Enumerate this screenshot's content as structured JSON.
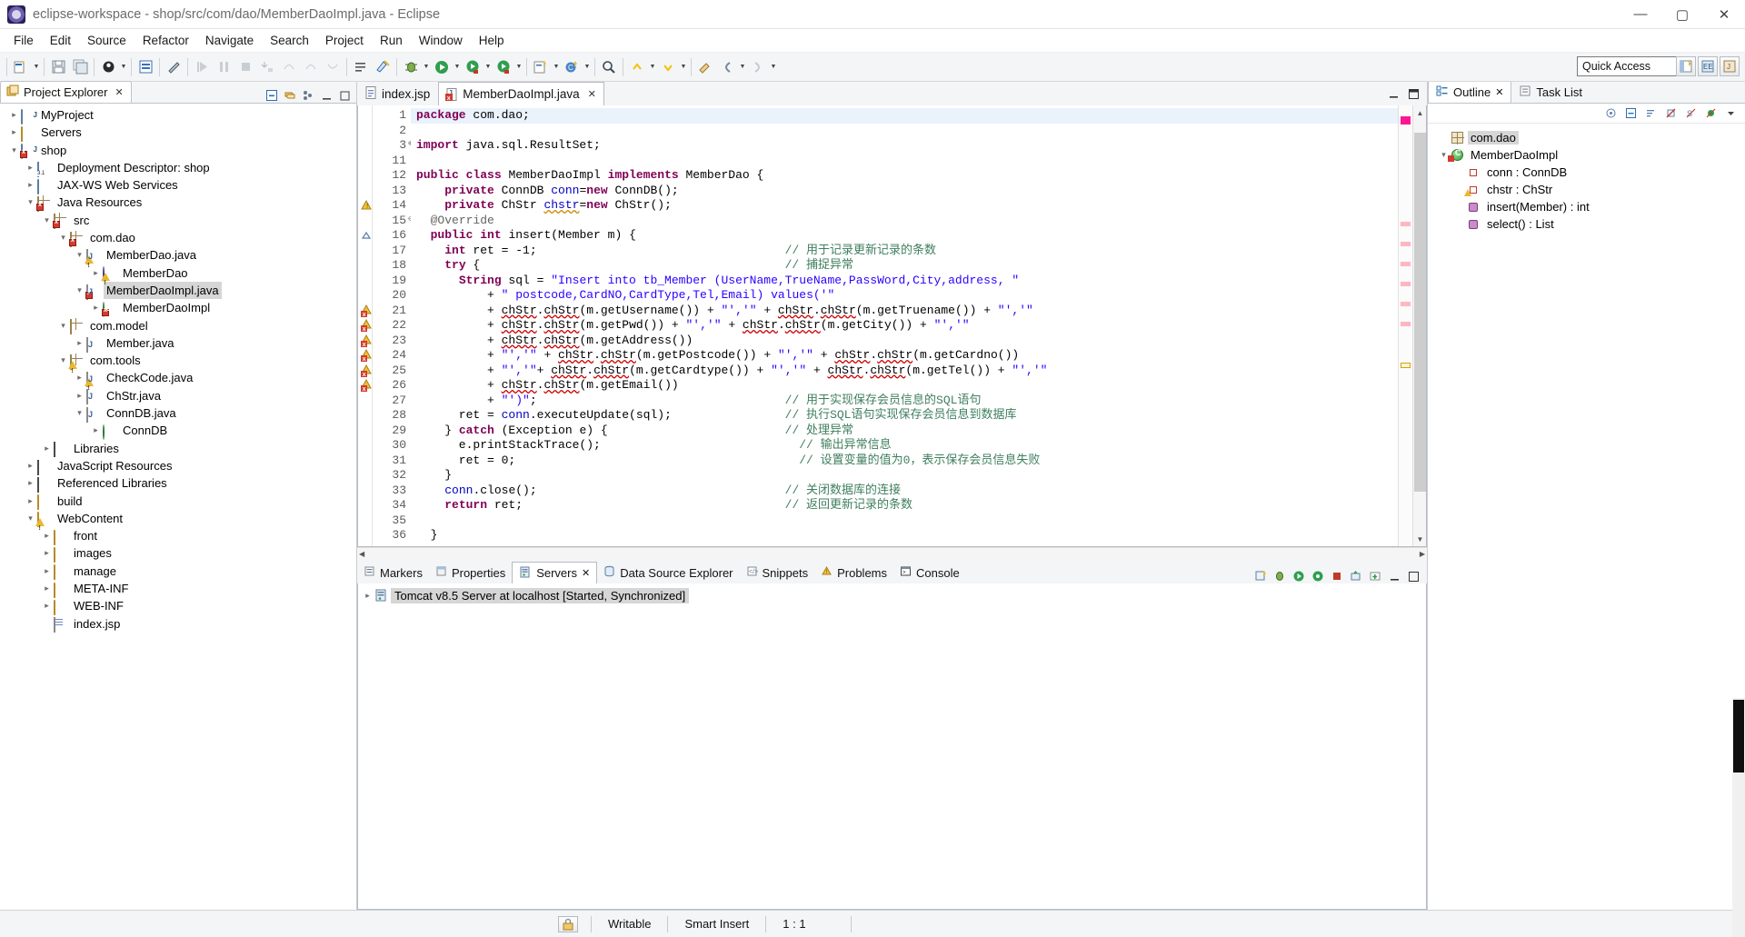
{
  "window": {
    "title": "eclipse-workspace - shop/src/com/dao/MemberDaoImpl.java - Eclipse",
    "minimize": "—",
    "maximize": "▢",
    "close": "✕"
  },
  "menu": {
    "items": [
      "File",
      "Edit",
      "Source",
      "Refactor",
      "Navigate",
      "Search",
      "Project",
      "Run",
      "Window",
      "Help"
    ]
  },
  "toolbar": {
    "quick_access_placeholder": "Quick Access",
    "quick_access_value": "Quick Access"
  },
  "project_explorer": {
    "tab_label": "Project Explorer",
    "close_glyph": "✕",
    "tree": [
      {
        "label": "MyProject",
        "indent": 0,
        "twisty": "▸",
        "icon": "java-project-icon"
      },
      {
        "label": "Servers",
        "indent": 0,
        "twisty": "▸",
        "icon": "folder-icon"
      },
      {
        "label": "shop",
        "indent": 0,
        "twisty": "▾",
        "icon": "java-project-error-icon"
      },
      {
        "label": "Deployment Descriptor: shop",
        "indent": 1,
        "twisty": "▸",
        "icon": "deployment-descriptor-icon"
      },
      {
        "label": "JAX-WS Web Services",
        "indent": 1,
        "twisty": "▸",
        "icon": "web-services-icon"
      },
      {
        "label": "Java Resources",
        "indent": 1,
        "twisty": "▾",
        "icon": "java-resources-error-icon"
      },
      {
        "label": "src",
        "indent": 2,
        "twisty": "▾",
        "icon": "source-folder-error-icon"
      },
      {
        "label": "com.dao",
        "indent": 3,
        "twisty": "▾",
        "icon": "package-error-icon"
      },
      {
        "label": "MemberDao.java",
        "indent": 4,
        "twisty": "▾",
        "icon": "java-file-warning-icon"
      },
      {
        "label": "MemberDao",
        "indent": 5,
        "twisty": "▸",
        "icon": "interface-warning-icon"
      },
      {
        "label": "MemberDaoImpl.java",
        "indent": 4,
        "twisty": "▾",
        "icon": "java-file-error-icon",
        "selected": true
      },
      {
        "label": "MemberDaoImpl",
        "indent": 5,
        "twisty": "▸",
        "icon": "class-error-icon"
      },
      {
        "label": "com.model",
        "indent": 3,
        "twisty": "▾",
        "icon": "package-icon"
      },
      {
        "label": "Member.java",
        "indent": 4,
        "twisty": "▸",
        "icon": "java-file-icon"
      },
      {
        "label": "com.tools",
        "indent": 3,
        "twisty": "▾",
        "icon": "package-warning-icon"
      },
      {
        "label": "CheckCode.java",
        "indent": 4,
        "twisty": "▸",
        "icon": "java-file-warning-icon"
      },
      {
        "label": "ChStr.java",
        "indent": 4,
        "twisty": "▸",
        "icon": "java-file-icon"
      },
      {
        "label": "ConnDB.java",
        "indent": 4,
        "twisty": "▾",
        "icon": "java-file-icon"
      },
      {
        "label": "ConnDB",
        "indent": 5,
        "twisty": "▸",
        "icon": "class-icon"
      },
      {
        "label": "Libraries",
        "indent": 2,
        "twisty": "▸",
        "icon": "libraries-icon"
      },
      {
        "label": "JavaScript Resources",
        "indent": 1,
        "twisty": "▸",
        "icon": "libraries-icon"
      },
      {
        "label": "Referenced Libraries",
        "indent": 1,
        "twisty": "▸",
        "icon": "libraries-icon"
      },
      {
        "label": "build",
        "indent": 1,
        "twisty": "▸",
        "icon": "folder-icon"
      },
      {
        "label": "WebContent",
        "indent": 1,
        "twisty": "▾",
        "icon": "folder-warning-icon"
      },
      {
        "label": "front",
        "indent": 2,
        "twisty": "▸",
        "icon": "folder-icon"
      },
      {
        "label": "images",
        "indent": 2,
        "twisty": "▸",
        "icon": "folder-icon"
      },
      {
        "label": "manage",
        "indent": 2,
        "twisty": "▸",
        "icon": "folder-icon"
      },
      {
        "label": "META-INF",
        "indent": 2,
        "twisty": "▸",
        "icon": "folder-icon"
      },
      {
        "label": "WEB-INF",
        "indent": 2,
        "twisty": "▸",
        "icon": "folder-icon"
      },
      {
        "label": "index.jsp",
        "indent": 2,
        "twisty": "",
        "icon": "jsp-file-icon"
      }
    ]
  },
  "editor": {
    "tabs": [
      {
        "label": "index.jsp",
        "active": false,
        "icon": "jsp-file-icon",
        "closable": false
      },
      {
        "label": "MemberDaoImpl.java",
        "active": true,
        "icon": "java-file-error-icon",
        "closable": true,
        "close_glyph": "✕"
      }
    ],
    "minimize_glyph": "—",
    "maximize_glyph": "▢",
    "lines": [
      {
        "n": "1",
        "mark": "",
        "fold": "",
        "code": "package com.dao;",
        "highlight": true
      },
      {
        "n": "2",
        "mark": "",
        "fold": "",
        "code": ""
      },
      {
        "n": "3",
        "mark": "",
        "fold": "⊕",
        "code": "import java.sql.ResultSet;"
      },
      {
        "n": "11",
        "mark": "",
        "fold": "",
        "code": ""
      },
      {
        "n": "12",
        "mark": "",
        "fold": "",
        "code": "public class MemberDaoImpl implements MemberDao {"
      },
      {
        "n": "13",
        "mark": "",
        "fold": "",
        "code": "    private ConnDB conn=new ConnDB();"
      },
      {
        "n": "14",
        "mark": "warning",
        "fold": "",
        "code": "    private ChStr chstr=new ChStr();"
      },
      {
        "n": "15",
        "mark": "",
        "fold": "⊖",
        "code": "  @Override"
      },
      {
        "n": "16",
        "mark": "override",
        "fold": "",
        "code": "  public int insert(Member m) {"
      },
      {
        "n": "17",
        "mark": "",
        "fold": "",
        "code": "    int ret = -1;",
        "comment": "// 用于记录更新记录的条数"
      },
      {
        "n": "18",
        "mark": "",
        "fold": "",
        "code": "    try {",
        "comment": "// 捕捉异常"
      },
      {
        "n": "19",
        "mark": "",
        "fold": "",
        "code": "      String sql = \"Insert into tb_Member (UserName,TrueName,PassWord,City,address, \""
      },
      {
        "n": "20",
        "mark": "",
        "fold": "",
        "code": "          + \" postcode,CardNO,CardType,Tel,Email) values('\""
      },
      {
        "n": "21",
        "mark": "error",
        "fold": "",
        "code": "          + chStr.chStr(m.getUsername()) + \"','\" + chStr.chStr(m.getTruename()) + \"','\""
      },
      {
        "n": "22",
        "mark": "error",
        "fold": "",
        "code": "          + chStr.chStr(m.getPwd()) + \"','\" + chStr.chStr(m.getCity()) + \"','\""
      },
      {
        "n": "23",
        "mark": "error",
        "fold": "",
        "code": "          + chStr.chStr(m.getAddress())"
      },
      {
        "n": "24",
        "mark": "error",
        "fold": "",
        "code": "          + \"','\" + chStr.chStr(m.getPostcode()) + \"','\" + chStr.chStr(m.getCardno())"
      },
      {
        "n": "25",
        "mark": "error",
        "fold": "",
        "code": "          + \"','\"+ chStr.chStr(m.getCardtype()) + \"','\" + chStr.chStr(m.getTel()) + \"','\""
      },
      {
        "n": "26",
        "mark": "error",
        "fold": "",
        "code": "          + chStr.chStr(m.getEmail())"
      },
      {
        "n": "27",
        "mark": "",
        "fold": "",
        "code": "          + \"')\";",
        "comment": "// 用于实现保存会员信息的SQL语句"
      },
      {
        "n": "28",
        "mark": "",
        "fold": "",
        "code": "      ret = conn.executeUpdate(sql);",
        "comment": "// 执行SQL语句实现保存会员信息到数据库"
      },
      {
        "n": "29",
        "mark": "",
        "fold": "",
        "code": "    } catch (Exception e) {",
        "comment": "// 处理异常"
      },
      {
        "n": "30",
        "mark": "",
        "fold": "",
        "code": "      e.printStackTrace();",
        "comment": "  // 输出异常信息"
      },
      {
        "n": "31",
        "mark": "",
        "fold": "",
        "code": "      ret = 0;",
        "comment": "  // 设置变量的值为0，表示保存会员信息失败"
      },
      {
        "n": "32",
        "mark": "",
        "fold": "",
        "code": "    }"
      },
      {
        "n": "33",
        "mark": "",
        "fold": "",
        "code": "    conn.close();",
        "comment": "// 关闭数据库的连接"
      },
      {
        "n": "34",
        "mark": "",
        "fold": "",
        "code": "    return ret;",
        "comment": "// 返回更新记录的条数"
      },
      {
        "n": "35",
        "mark": "",
        "fold": "",
        "code": ""
      },
      {
        "n": "36",
        "mark": "",
        "fold": "",
        "code": "  }"
      },
      {
        "n": "",
        "mark": "",
        "fold": "",
        "code": ""
      }
    ]
  },
  "bottom_panel": {
    "tabs": [
      {
        "label": "Markers",
        "active": false,
        "icon": "markers-icon"
      },
      {
        "label": "Properties",
        "active": false,
        "icon": "properties-icon"
      },
      {
        "label": "Servers",
        "active": true,
        "icon": "servers-icon",
        "close_glyph": "✕"
      },
      {
        "label": "Data Source Explorer",
        "active": false,
        "icon": "data-source-icon"
      },
      {
        "label": "Snippets",
        "active": false,
        "icon": "snippets-icon"
      },
      {
        "label": "Problems",
        "active": false,
        "icon": "problems-icon"
      },
      {
        "label": "Console",
        "active": false,
        "icon": "console-icon"
      }
    ],
    "server_row": {
      "twisty": "▸",
      "label": "Tomcat v8.5 Server at localhost  [Started, Synchronized]"
    }
  },
  "outline": {
    "tabs": [
      {
        "label": "Outline",
        "active": true,
        "icon": "outline-icon",
        "close_glyph": "✕"
      },
      {
        "label": "Task List",
        "active": false,
        "icon": "task-list-icon"
      }
    ],
    "tree": [
      {
        "label": "com.dao",
        "indent": 0,
        "twisty": "",
        "icon": "package-icon",
        "selected": true
      },
      {
        "label": "MemberDaoImpl",
        "indent": 0,
        "twisty": "▾",
        "icon": "class-error-icon"
      },
      {
        "label": "conn : ConnDB",
        "indent": 1,
        "twisty": "",
        "icon": "field-icon"
      },
      {
        "label": "chstr : ChStr",
        "indent": 1,
        "twisty": "",
        "icon": "field-warning-icon"
      },
      {
        "label": "insert(Member) : int",
        "indent": 1,
        "twisty": "",
        "icon": "method-icon"
      },
      {
        "label": "select() : List",
        "indent": 1,
        "twisty": "",
        "icon": "method-icon"
      }
    ]
  },
  "statusbar": {
    "writable": "Writable",
    "insert_mode": "Smart Insert",
    "position": "1 : 1"
  }
}
